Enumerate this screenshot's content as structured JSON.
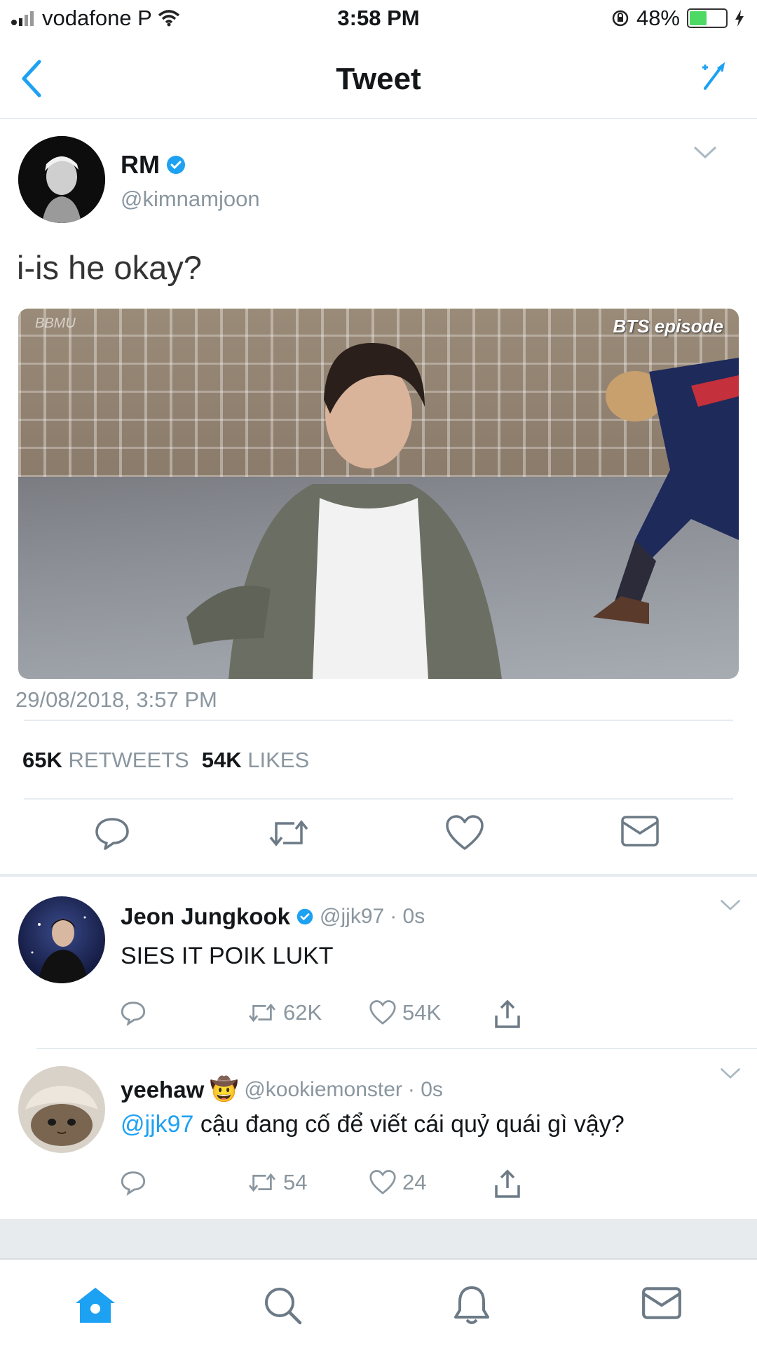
{
  "status_bar": {
    "carrier": "vodafone P",
    "time": "3:58 PM",
    "battery_percent": "48%",
    "battery_level": 0.48
  },
  "nav": {
    "title": "Tweet"
  },
  "tweet": {
    "author_name": "RM",
    "author_handle": "@kimnamjoon",
    "text": "i-is he okay?",
    "media_watermark_left": "BBMU",
    "media_watermark_right": "BTS episode",
    "timestamp": "29/08/2018, 3:57 PM",
    "retweets_count": "65K",
    "retweets_label": "RETWEETS",
    "likes_count": "54K",
    "likes_label": "LIKES"
  },
  "replies": [
    {
      "name": "Jeon Jungkook",
      "handle": "@jjk97",
      "time": "· 0s",
      "text": "SIES IT POIK LUKT",
      "retweets": "62K",
      "likes": "54K"
    },
    {
      "name": "yeehaw",
      "emoji": "🤠",
      "handle": "@kookiemonster",
      "time": "· 0s",
      "mention": "@jjk97",
      "text": "cậu đang cố để viết cái quỷ quái gì vậy?",
      "retweets": "54",
      "likes": "24"
    }
  ],
  "colors": {
    "accent": "#1da1f2",
    "verified": "#1da1f2",
    "secondary_text": "#8a969f",
    "divider": "#e6ecf0",
    "battery_fill": "#4cd964"
  },
  "icons": {
    "reply": "reply-icon",
    "retweet": "retweet-icon",
    "like": "heart-icon",
    "dm": "envelope-icon",
    "share": "share-icon",
    "home": "home-icon",
    "search": "search-icon",
    "notifications": "bell-icon",
    "messages": "envelope-icon"
  }
}
